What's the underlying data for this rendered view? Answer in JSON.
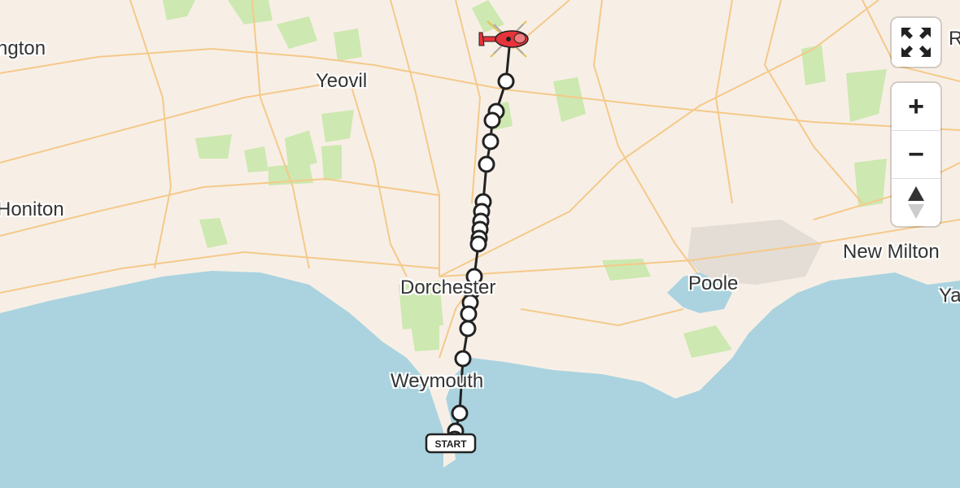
{
  "map": {
    "places": [
      {
        "name": "ngton"
      },
      {
        "name": "Yeovil"
      },
      {
        "name": "Honiton"
      },
      {
        "name": "Dorchester"
      },
      {
        "name": "Weymouth"
      },
      {
        "name": "Poole"
      },
      {
        "name": "New Milton"
      },
      {
        "name": "Ya"
      },
      {
        "name": "R"
      }
    ],
    "start_label": "START",
    "colors": {
      "land": "#f7efe6",
      "sea": "#aad3df",
      "road": "#f5c98a",
      "green": "#cde8b0",
      "route": "#222222",
      "marker_fill": "#ffffff",
      "helicopter": "#e8333a"
    },
    "helicopter_icon": "helicopter-icon"
  },
  "controls": {
    "fullscreen_icon": "fullscreen-icon",
    "zoom_in": "+",
    "zoom_out": "−",
    "compass_icon": "compass-icon"
  }
}
